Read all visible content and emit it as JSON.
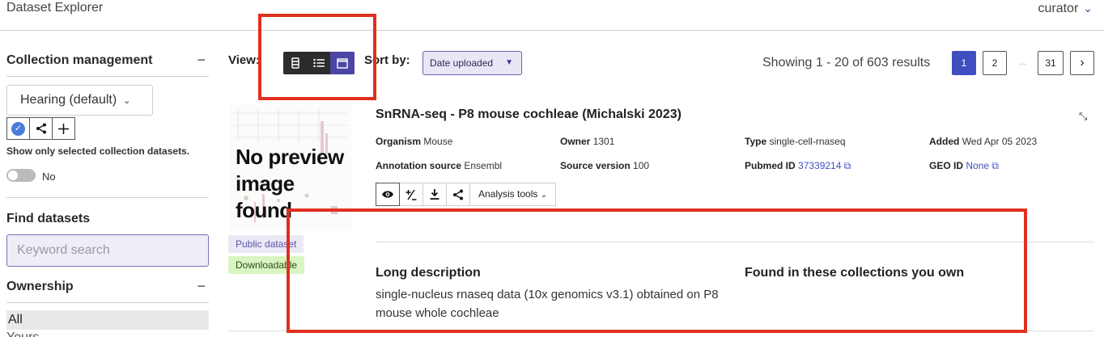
{
  "header": {
    "app_title": "Dataset Explorer",
    "user": "curator"
  },
  "sidebar": {
    "collection_management": {
      "title": "Collection management",
      "selected_collection": "Hearing (default)",
      "show_only_label": "Show only selected collection datasets.",
      "toggle_label": "No",
      "toggle_on": false
    },
    "find_datasets": {
      "title": "Find datasets",
      "search_placeholder": "Keyword search"
    },
    "ownership": {
      "title": "Ownership",
      "options": [
        "All",
        "Yours"
      ]
    }
  },
  "toolbar": {
    "view_label": "View:",
    "view_modes": [
      "compact",
      "list",
      "expanded"
    ],
    "active_view": "expanded",
    "sort_label": "Sort by:",
    "sort_value": "Date uploaded",
    "results_text": "Showing 1 - 20 of 603 results",
    "pages": [
      "1",
      "2",
      "...",
      "31",
      "›"
    ],
    "current_page": "1"
  },
  "dataset": {
    "title": "SnRNA-seq - P8 mouse cochleae (Michalski 2023)",
    "thumbnail_text": "No preview image found",
    "badges": [
      "Public dataset",
      "Downloadable"
    ],
    "meta": {
      "organism_label": "Organism",
      "organism": "Mouse",
      "owner_label": "Owner",
      "owner": "1301",
      "type_label": "Type",
      "type": "single-cell-rnaseq",
      "added_label": "Added",
      "added": "Wed Apr 05 2023",
      "annotation_label": "Annotation source",
      "annotation": "Ensembl",
      "version_label": "Source version",
      "version": "100",
      "pubmed_label": "Pubmed ID",
      "pubmed": "37339214",
      "geo_label": "GEO ID",
      "geo": "None"
    },
    "actions": {
      "analysis_tools": "Analysis tools"
    },
    "long_description_title": "Long description",
    "long_description": "single-nucleus rnaseq data (10x genomics v3.1) obtained on P8 mouse whole cochleae",
    "collections_title": "Found in these collections you own"
  },
  "colors": {
    "accent": "#4b46a6",
    "page_active": "#3f4fc2",
    "annotation_box": "#e0301e",
    "downloadable_bg": "#d9f5c2"
  }
}
